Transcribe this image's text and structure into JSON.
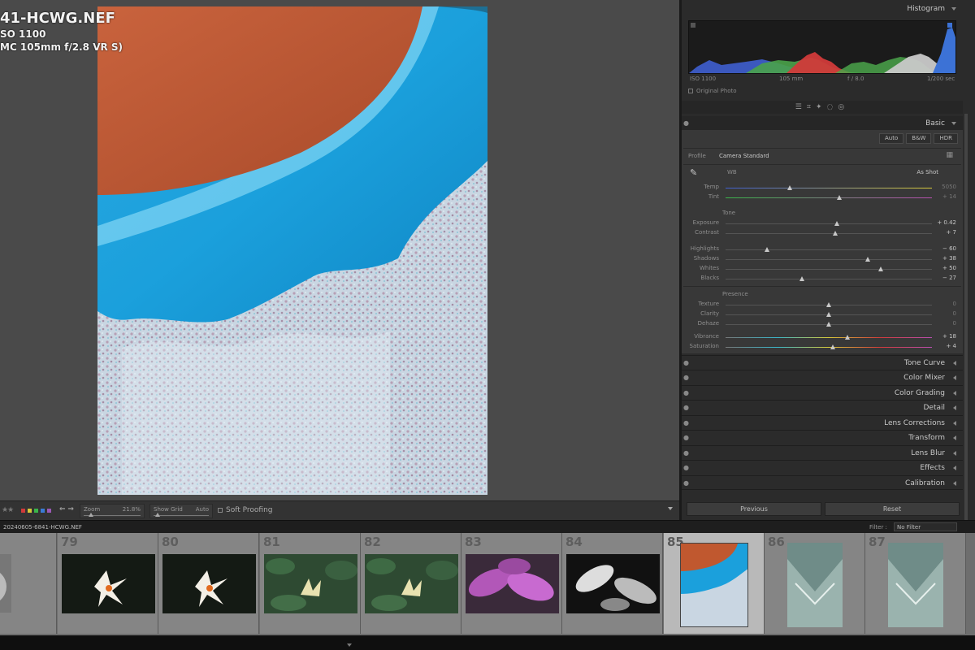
{
  "photo_info": {
    "filename": "41-HCWG.NEF",
    "iso": "SO 1100",
    "lens": "MC 105mm f/2.8 VR S)"
  },
  "toolbar": {
    "zoom_label": "Zoom",
    "zoom_value": "21.8%",
    "grid_label": "Show Grid",
    "grid_value": "Auto",
    "soft_proofing": "Soft Proofing",
    "flag_colors": [
      "#d13a3a",
      "#d6c83a",
      "#3ab54a",
      "#3a7bd6",
      "#9b59b6"
    ]
  },
  "histogram": {
    "title": "Histogram",
    "iso": "ISO 1100",
    "focal": "105 mm",
    "aperture": "f / 8.0",
    "shutter": "1/200 sec",
    "original_photo": "Original Photo"
  },
  "basic": {
    "title": "Basic",
    "buttons": [
      "Auto",
      "B&W",
      "HDR"
    ],
    "profile_label": "Profile",
    "profile_value": "Camera Standard",
    "wb_label": "WB",
    "wb_value": "As Shot",
    "tone_label": "Tone",
    "presence_label": "Presence",
    "sliders": {
      "temp": {
        "label": "Temp",
        "value": "5050",
        "pos": 0.31
      },
      "tint": {
        "label": "Tint",
        "value": "+ 14",
        "pos": 0.55
      },
      "exposure": {
        "label": "Exposure",
        "value": "+ 0.42",
        "pos": 0.54
      },
      "contrast": {
        "label": "Contrast",
        "value": "+ 7",
        "pos": 0.53
      },
      "highlights": {
        "label": "Highlights",
        "value": "− 60",
        "pos": 0.2
      },
      "shadows": {
        "label": "Shadows",
        "value": "+ 38",
        "pos": 0.69
      },
      "whites": {
        "label": "Whites",
        "value": "+ 50",
        "pos": 0.75
      },
      "blacks": {
        "label": "Blacks",
        "value": "− 27",
        "pos": 0.37
      },
      "texture": {
        "label": "Texture",
        "value": "0",
        "pos": 0.5
      },
      "clarity": {
        "label": "Clarity",
        "value": "0",
        "pos": 0.5
      },
      "dehaze": {
        "label": "Dehaze",
        "value": "0",
        "pos": 0.5
      },
      "vibrance": {
        "label": "Vibrance",
        "value": "+ 18",
        "pos": 0.59
      },
      "saturation": {
        "label": "Saturation",
        "value": "+ 4",
        "pos": 0.52
      }
    }
  },
  "panels": [
    "Tone Curve",
    "Color Mixer",
    "Color Grading",
    "Detail",
    "Lens Corrections",
    "Transform",
    "Lens Blur",
    "Effects",
    "Calibration"
  ],
  "actions": {
    "previous": "Previous",
    "reset": "Reset"
  },
  "filmstrip": {
    "path": "20240605-6841-HCWG.NEF",
    "filter_label": "Filter :",
    "filter_value": "No Filter",
    "numbers": [
      "79",
      "80",
      "81",
      "82",
      "83",
      "84",
      "85",
      "86",
      "87"
    ],
    "selected": "85"
  }
}
